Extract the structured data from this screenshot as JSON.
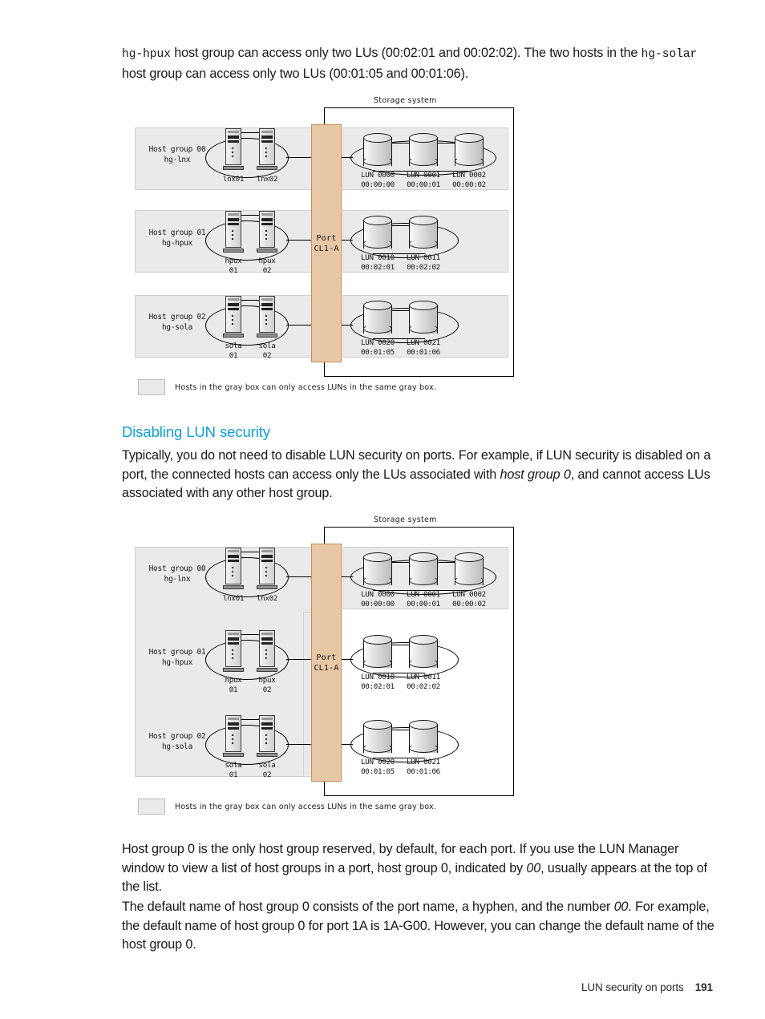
{
  "intro": {
    "line1_mono": "hg-hpux",
    "line1_rest": " host group can access only two LUs (00:02:01 and 00:02:02). The two hosts in the",
    "line2_mono": "hg-solar",
    "line2_rest": " host group can access only two LUs (00:01:05 and 00:01:06)."
  },
  "section": {
    "heading": "Disabling LUN security",
    "para1_a": "Typically, you do not need to disable LUN security on ports. For example, if LUN security is disabled on a port, the connected hosts can access only the LUs associated with ",
    "para1_em": "host group 0",
    "para1_b": ", and cannot access LUs associated with any other host group."
  },
  "closing": {
    "p1_a": "Host group 0 is the only host group reserved, by default, for each port. If you use the LUN Manager window to view a list of host groups in a port, host group 0, indicated by ",
    "p1_em": "00",
    "p1_b": ", usually appears at the top of the list.",
    "p2_a": "The default name of host group 0 consists of the port name, a hyphen, and the number ",
    "p2_em": "00",
    "p2_b": ". For example, the default name of host group 0 for port 1A is 1A-G00. However, you can change the default name of the host group 0."
  },
  "footer": {
    "title": "LUN security on ports",
    "page": "191"
  },
  "diagram_common": {
    "storage_system_label": "Storage system",
    "port_line1": "Port",
    "port_line2": "CL1-A",
    "legend_text": "Hosts in the gray box can only access LUNs in the same gray box.",
    "colors": {
      "port_fill": "#e8c7a6",
      "port_border": "#c68f5c",
      "gray_box": "#eaeaea",
      "heading": "#0f9ede"
    }
  },
  "diagram1": {
    "groups": [
      {
        "label_line1": "Host group 00",
        "label_line2": "hg-lnx",
        "hosts": [
          {
            "line1": "lnx01",
            "line2": ""
          },
          {
            "line1": "lnx02",
            "line2": ""
          }
        ],
        "luns": [
          {
            "name": "LUN 0000",
            "id": "00:00:00"
          },
          {
            "name": "LUN 0001",
            "id": "00:00:01"
          },
          {
            "name": "LUN 0002",
            "id": "00:00:02"
          }
        ]
      },
      {
        "label_line1": "Host group 01",
        "label_line2": "hg-hpux",
        "hosts": [
          {
            "line1": "hpux",
            "line2": "01"
          },
          {
            "line1": "hpux",
            "line2": "02"
          }
        ],
        "luns": [
          {
            "name": "LUN 0010",
            "id": "00:02:01"
          },
          {
            "name": "LUN 0011",
            "id": "00:02:02"
          }
        ]
      },
      {
        "label_line1": "Host group 02",
        "label_line2": "hg-sola",
        "hosts": [
          {
            "line1": "sola",
            "line2": "01"
          },
          {
            "line1": "sola",
            "line2": "02"
          }
        ],
        "luns": [
          {
            "name": "LUN 0020",
            "id": "00:01:05"
          },
          {
            "name": "LUN 0021",
            "id": "00:01:06"
          }
        ]
      }
    ]
  },
  "diagram2": {
    "groups": [
      {
        "label_line1": "Host group 00",
        "label_line2": "hg-lnx",
        "hosts": [
          {
            "line1": "lnx01",
            "line2": ""
          },
          {
            "line1": "lnx02",
            "line2": ""
          }
        ],
        "luns": [
          {
            "name": "LUN 0000",
            "id": "00:00:00"
          },
          {
            "name": "LUN 0001",
            "id": "00:00:01"
          },
          {
            "name": "LUN 0002",
            "id": "00:00:02"
          }
        ]
      },
      {
        "label_line1": "Host group 01",
        "label_line2": "hg-hpux",
        "hosts": [
          {
            "line1": "hpux",
            "line2": "01"
          },
          {
            "line1": "hpux",
            "line2": "02"
          }
        ],
        "luns": [
          {
            "name": "LUN 0010",
            "id": "00:02:01"
          },
          {
            "name": "LUN 0011",
            "id": "00:02:02"
          }
        ]
      },
      {
        "label_line1": "Host group 02",
        "label_line2": "hg-sola",
        "hosts": [
          {
            "line1": "sola",
            "line2": "01"
          },
          {
            "line1": "sola",
            "line2": "02"
          }
        ],
        "luns": [
          {
            "name": "LUN 0020",
            "id": "00:01:05"
          },
          {
            "name": "LUN 0021",
            "id": "00:01:06"
          }
        ]
      }
    ]
  }
}
